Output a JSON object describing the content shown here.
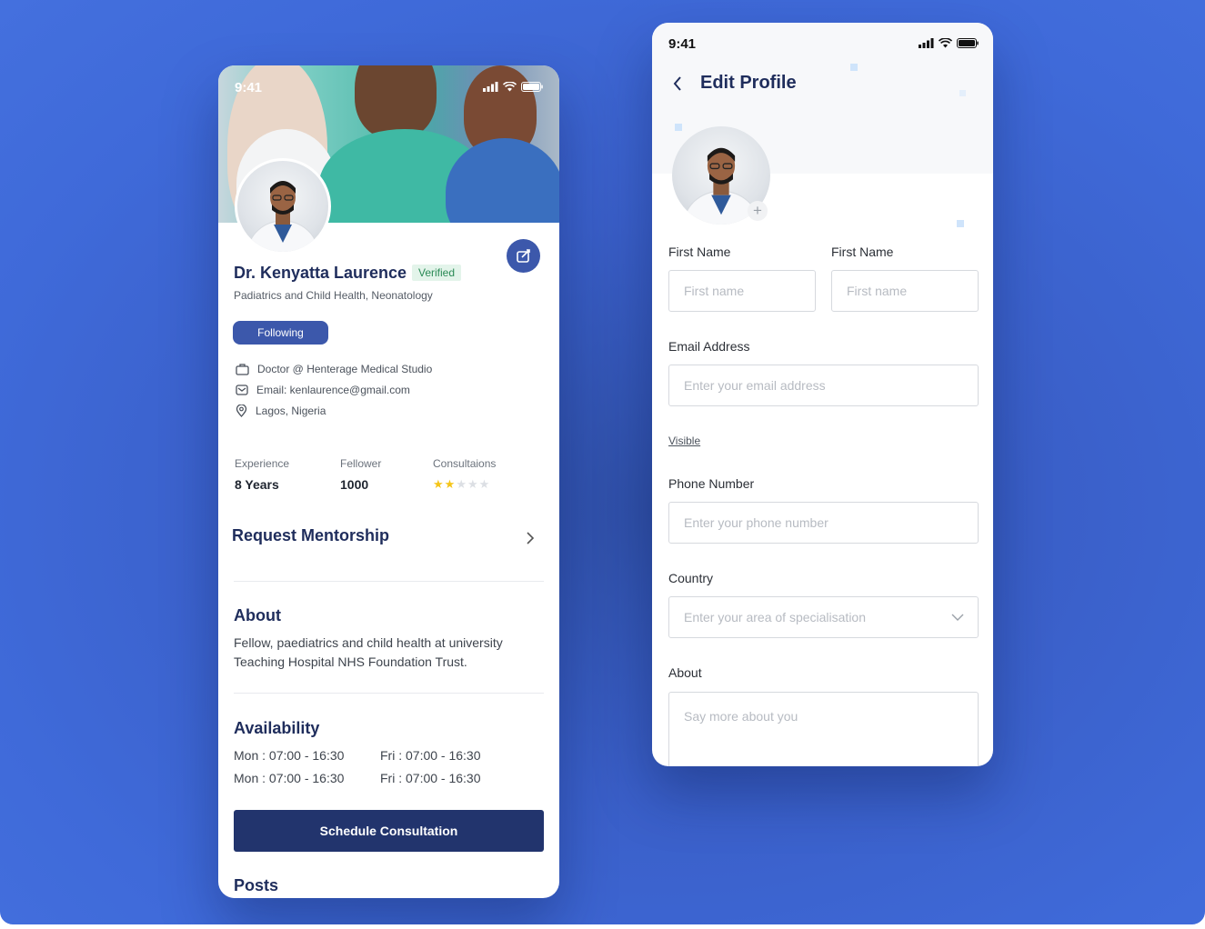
{
  "colors": {
    "brand_primary": "#3c58ab",
    "brand_dark": "#22346d",
    "heading": "#1f2d5c",
    "verified_bg": "#e3f4ea",
    "verified_text": "#2a8a55",
    "star_filled": "#f5c518",
    "star_empty": "#dcdfe4"
  },
  "profile_screen": {
    "status_time": "9:41",
    "doctor_name": "Dr. Kenyatta Laurence",
    "verified_label": "Verified",
    "specialty": "Padiatrics and Child Health, Neonatology",
    "following_button": "Following",
    "info": [
      {
        "icon": "briefcase-icon",
        "text": "Doctor @ Henterage Medical Studio"
      },
      {
        "icon": "mail-icon",
        "text": "Email: kenlaurence@gmail.com"
      },
      {
        "icon": "location-pin-icon",
        "text": "Lagos, Nigeria"
      }
    ],
    "stats": {
      "experience_label": "Experience",
      "experience_value": "8 Years",
      "fellower_label": "Fellower",
      "fellower_value": "1000",
      "consultations_label": "Consultaions",
      "rating": 2,
      "rating_max": 5
    },
    "mentorship_label": "Request Mentorship",
    "about_title": "About",
    "about_text_1": "Fellow, paediatrics and child health at university",
    "about_text_2": "Teaching Hospital NHS Foundation Trust.",
    "availability_title": "Availability",
    "availability": [
      {
        "left": "Mon : 07:00 - 16:30",
        "right": "Fri : 07:00 - 16:30"
      },
      {
        "left": "Mon : 07:00 - 16:30",
        "right": "Fri : 07:00 - 16:30"
      }
    ],
    "schedule_button": "Schedule Consultation",
    "posts_title": "Posts"
  },
  "edit_screen": {
    "status_time": "9:41",
    "title": "Edit Profile",
    "first_name_label": "First Name",
    "first_name_placeholder": "First name",
    "second_name_label": "First Name",
    "second_name_placeholder": "First name",
    "email_label": "Email Address",
    "email_placeholder": "Enter your email address",
    "visible_link": "Visible",
    "phone_label": "Phone Number",
    "phone_placeholder": "Enter your phone number",
    "country_label": "Country",
    "country_placeholder": "Enter your area of specialisation",
    "about_label": "About",
    "about_placeholder": "Say more about you"
  }
}
